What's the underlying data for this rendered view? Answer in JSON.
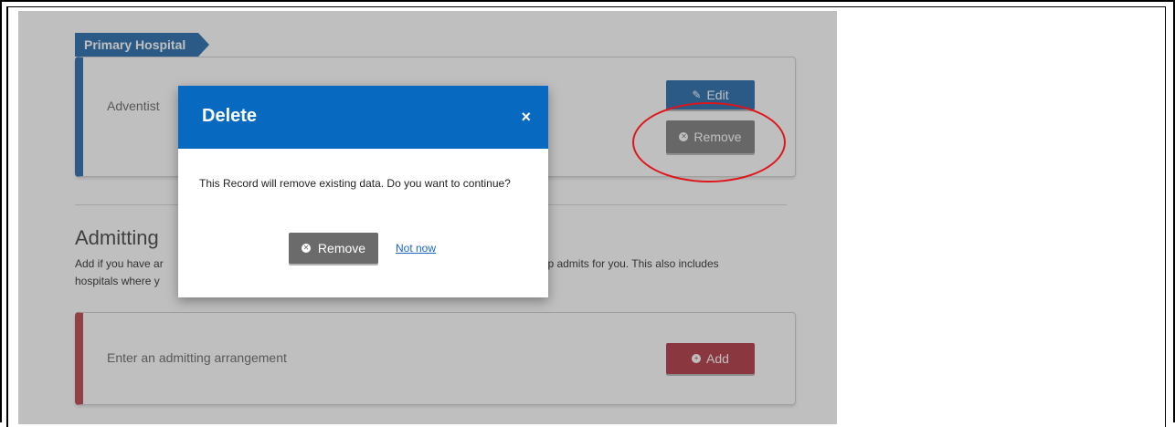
{
  "primary_hospital": {
    "ribbon_label": "Primary Hospital",
    "name_partial": "Adventist",
    "edit_label": "Edit",
    "remove_label": "Remove"
  },
  "admitting": {
    "title_partial": "Admitting",
    "description_left_1": "Add if you have ar",
    "description_right_1": "group admits for you. This also includes",
    "description_left_2": "hospitals where y",
    "placeholder": "Enter an admitting arrangement",
    "add_label": "Add"
  },
  "modal": {
    "title": "Delete",
    "close_icon": "×",
    "message": "This Record will remove existing data. Do you want to continue?",
    "remove_label": "Remove",
    "cancel_label": "Not now"
  },
  "colors": {
    "primary_blue": "#3a78b5",
    "modal_header": "#0769bf",
    "add_red": "#b94a55",
    "annotation_red": "#e0141b"
  }
}
